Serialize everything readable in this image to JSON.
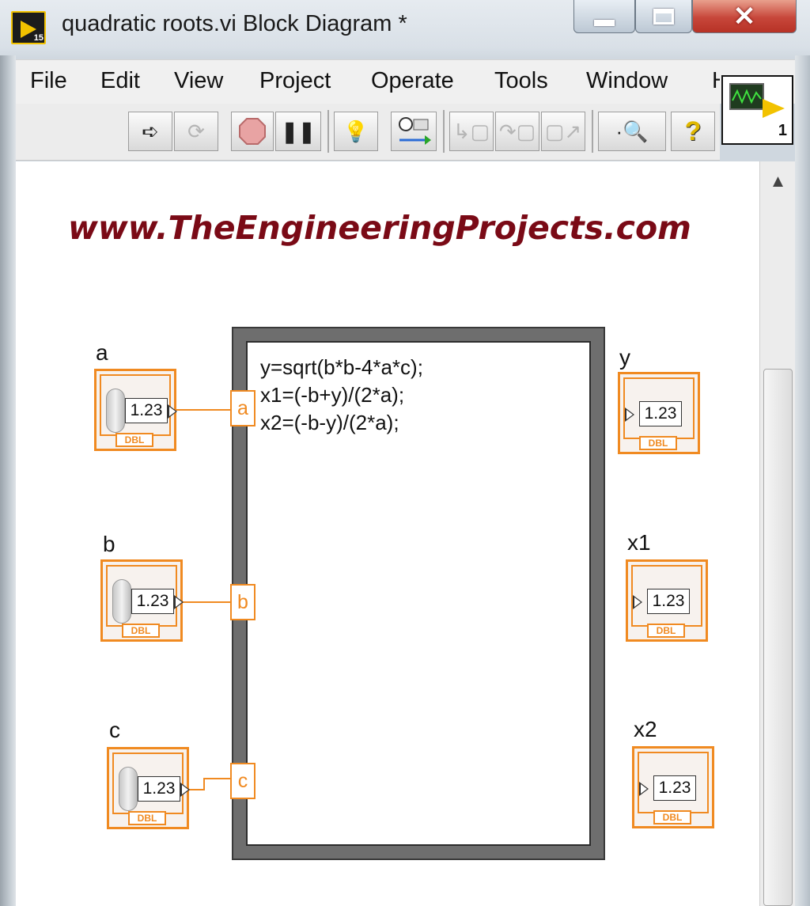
{
  "window": {
    "title": "quadratic roots.vi Block Diagram *",
    "app_icon_version": "15",
    "icons": {
      "minimize": "minimize-icon",
      "maximize": "maximize-icon",
      "close": "close-icon"
    }
  },
  "menubar": {
    "items": [
      "File",
      "Edit",
      "View",
      "Project",
      "Operate",
      "Tools",
      "Window",
      "H"
    ]
  },
  "toolbar": {
    "buttons": [
      {
        "icon": "run-icon",
        "enabled": true
      },
      {
        "icon": "run-continuously-icon",
        "enabled": false
      },
      {
        "icon": "abort-icon",
        "enabled": true
      },
      {
        "icon": "pause-icon",
        "enabled": true
      },
      {
        "icon": "highlight-execution-icon",
        "enabled": true
      },
      {
        "icon": "retain-wire-values-icon",
        "enabled": true
      },
      {
        "icon": "step-into-icon",
        "enabled": false
      },
      {
        "icon": "step-over-icon",
        "enabled": false
      },
      {
        "icon": "step-out-icon",
        "enabled": false
      },
      {
        "icon": "search-icon",
        "enabled": true
      },
      {
        "icon": "help-icon",
        "enabled": true
      }
    ],
    "vi_icon_number": "1"
  },
  "canvas": {
    "watermark": "www.TheEngineeringProjects.com",
    "formula_node": {
      "lines": [
        "y=sqrt(b*b-4*a*c);",
        "x1=(-b+y)/(2*a);",
        "x2=(-b-y)/(2*a);"
      ],
      "inputs": [
        "a",
        "b",
        "c"
      ]
    },
    "controls": [
      {
        "label": "a",
        "value": "1.23",
        "type": "DBL"
      },
      {
        "label": "b",
        "value": "1.23",
        "type": "DBL"
      },
      {
        "label": "c",
        "value": "1.23",
        "type": "DBL"
      }
    ],
    "indicators": [
      {
        "label": "y",
        "value": "1.23",
        "type": "DBL"
      },
      {
        "label": "x1",
        "value": "1.23",
        "type": "DBL"
      },
      {
        "label": "x2",
        "value": "1.23",
        "type": "DBL"
      }
    ]
  },
  "colors": {
    "wire_orange": "#f08a21",
    "watermark_red": "#7a0a16",
    "formula_node_border": "#6e6e6e"
  }
}
